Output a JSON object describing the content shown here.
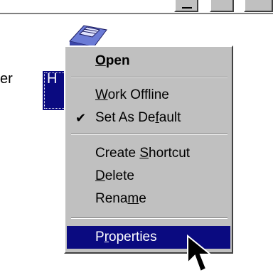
{
  "desktop": {
    "left_text": "er",
    "selected_label": "H"
  },
  "menu": {
    "items": [
      {
        "label": "Open",
        "mnemonic": "O",
        "default": true
      },
      {
        "label": "Work Offline",
        "mnemonic": "W"
      },
      {
        "label": "Set As Default",
        "mnemonic": "f",
        "checked": true
      },
      {
        "label": "Create Shortcut",
        "mnemonic": "S"
      },
      {
        "label": "Delete",
        "mnemonic": "D"
      },
      {
        "label": "Rename",
        "mnemonic": "m"
      },
      {
        "label": "Properties",
        "mnemonic": "r",
        "highlighted": true
      }
    ],
    "check_glyph": "✔"
  },
  "icons": {
    "printer": "printer-icon",
    "cursor": "mouse-pointer-icon"
  },
  "colors": {
    "menu_bg": "#c0c0c0",
    "highlight": "#0a0a80",
    "highlight_text": "#ffffff"
  }
}
